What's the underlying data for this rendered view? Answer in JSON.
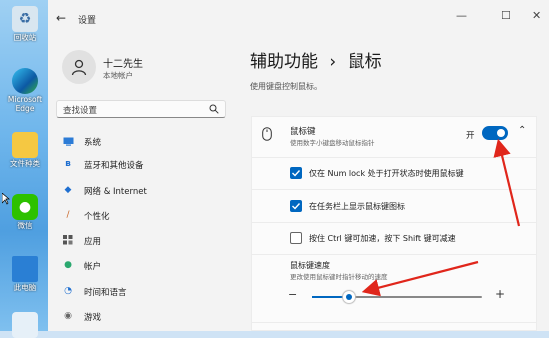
{
  "desktop": {
    "icons": [
      {
        "label": "回收站"
      },
      {
        "label": "Microsoft Edge"
      },
      {
        "label": "文件种类"
      },
      {
        "label": "微信"
      },
      {
        "label": "此电脑"
      }
    ]
  },
  "window": {
    "title": "设置",
    "controls": {
      "minimize": "—",
      "maximize": "☐",
      "close": "✕"
    }
  },
  "user": {
    "name": "十二先生",
    "account": "本地帐户"
  },
  "search": {
    "placeholder": "查找设置"
  },
  "sidebar": {
    "items": [
      {
        "label": "系统"
      },
      {
        "label": "蓝牙和其他设备"
      },
      {
        "label": "网络 & Internet"
      },
      {
        "label": "个性化"
      },
      {
        "label": "应用"
      },
      {
        "label": "帐户"
      },
      {
        "label": "时间和语言"
      },
      {
        "label": "游戏"
      }
    ]
  },
  "page": {
    "breadcrumb_parent": "辅助功能",
    "breadcrumb_sep": "›",
    "breadcrumb_current": "鼠标",
    "subtitle": "使用键盘控制鼠标。"
  },
  "mouse_keys": {
    "title": "鼠标键",
    "description": "使用数字小键盘移动鼠标指针",
    "state_label": "开",
    "enabled": true,
    "options": [
      {
        "label": "仅在 Num lock 处于打开状态时使用鼠标键",
        "checked": true
      },
      {
        "label": "在任务栏上显示鼠标键图标",
        "checked": true
      },
      {
        "label": "按住 Ctrl 键可加速，按下 Shift 键可减速",
        "checked": false
      }
    ]
  },
  "speed": {
    "title": "鼠标键速度",
    "description": "更改使用鼠标键时指针移动的速度",
    "minus": "−",
    "plus": "+",
    "level": 0.22
  },
  "colors": {
    "accent": "#0067c0",
    "annotation": "#e0261b"
  }
}
